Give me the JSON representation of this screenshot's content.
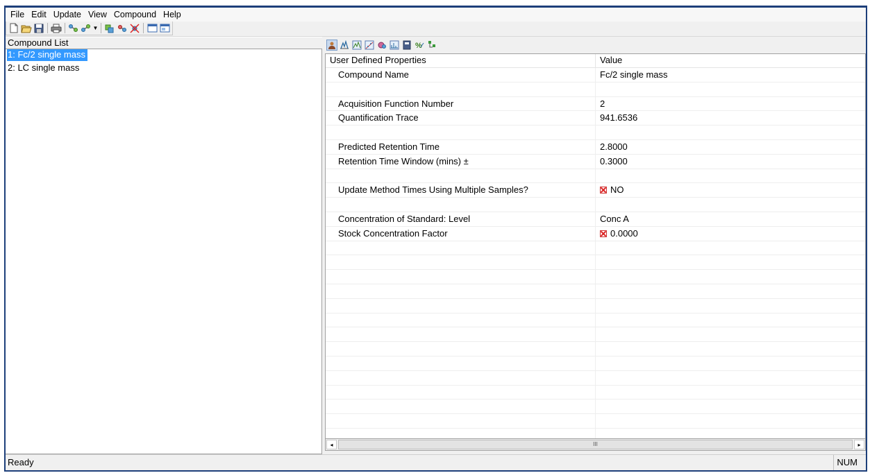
{
  "menu": {
    "items": [
      "File",
      "Edit",
      "Update",
      "View",
      "Compound",
      "Help"
    ]
  },
  "toolbar": {
    "icons": [
      "new-document-icon",
      "open-folder-icon",
      "save-icon",
      "print-icon",
      "add-compound-icon",
      "insert-compound-icon",
      "dropdown-arrow-icon",
      "copy-compound-icon",
      "move-compound-icon",
      "delete-compound-icon",
      "view-list-icon",
      "view-window-icon"
    ]
  },
  "compound_list": {
    "header": "Compound List",
    "items": [
      {
        "label": "1: Fc/2 single mass",
        "selected": true
      },
      {
        "label": "2: LC single mass",
        "selected": false
      }
    ]
  },
  "properties_toolbar": {
    "icons": [
      "user-properties-icon",
      "peak-detection-icon",
      "chromatogram-icon",
      "calibration-icon",
      "mass-spectrum-icon",
      "integration-icon",
      "report-icon",
      "percent-icon",
      "tree-icon"
    ]
  },
  "properties": {
    "header_property": "User Defined Properties",
    "header_value": "Value",
    "rows": [
      {
        "name": "Compound Name",
        "value": "Fc/2 single mass",
        "flag": false
      },
      {
        "name": "",
        "value": "",
        "flag": false
      },
      {
        "name": "Acquisition Function Number",
        "value": "2",
        "flag": false
      },
      {
        "name": "Quantification Trace",
        "value": "941.6536",
        "flag": false
      },
      {
        "name": "",
        "value": "",
        "flag": false
      },
      {
        "name": "Predicted Retention Time",
        "value": "2.8000",
        "flag": false
      },
      {
        "name": "Retention Time Window (mins) ±",
        "value": "0.3000",
        "flag": false
      },
      {
        "name": "",
        "value": "",
        "flag": false
      },
      {
        "name": "Update Method Times Using Multiple Samples?",
        "value": "NO",
        "flag": true
      },
      {
        "name": "",
        "value": "",
        "flag": false
      },
      {
        "name": "Concentration of Standard: Level",
        "value": "Conc A",
        "flag": false
      },
      {
        "name": "Stock Concentration Factor",
        "value": "0.0000",
        "flag": true
      },
      {
        "name": "",
        "value": "",
        "flag": false
      },
      {
        "name": "",
        "value": "",
        "flag": false
      },
      {
        "name": "",
        "value": "",
        "flag": false
      },
      {
        "name": "",
        "value": "",
        "flag": false
      },
      {
        "name": "",
        "value": "",
        "flag": false
      },
      {
        "name": "",
        "value": "",
        "flag": false
      },
      {
        "name": "",
        "value": "",
        "flag": false
      },
      {
        "name": "",
        "value": "",
        "flag": false
      },
      {
        "name": "",
        "value": "",
        "flag": false
      },
      {
        "name": "",
        "value": "",
        "flag": false
      },
      {
        "name": "",
        "value": "",
        "flag": false
      },
      {
        "name": "",
        "value": "",
        "flag": false
      },
      {
        "name": "",
        "value": "",
        "flag": false
      },
      {
        "name": "",
        "value": "",
        "flag": false
      }
    ]
  },
  "scrollbar": {
    "left_arrow": "◂",
    "right_arrow": "▸",
    "grip": "III"
  },
  "status": {
    "left": "Ready",
    "right": "NUM"
  },
  "colors": {
    "selection": "#3399ff",
    "window_border": "#1d3f7a",
    "flag_red": "#d22222"
  }
}
